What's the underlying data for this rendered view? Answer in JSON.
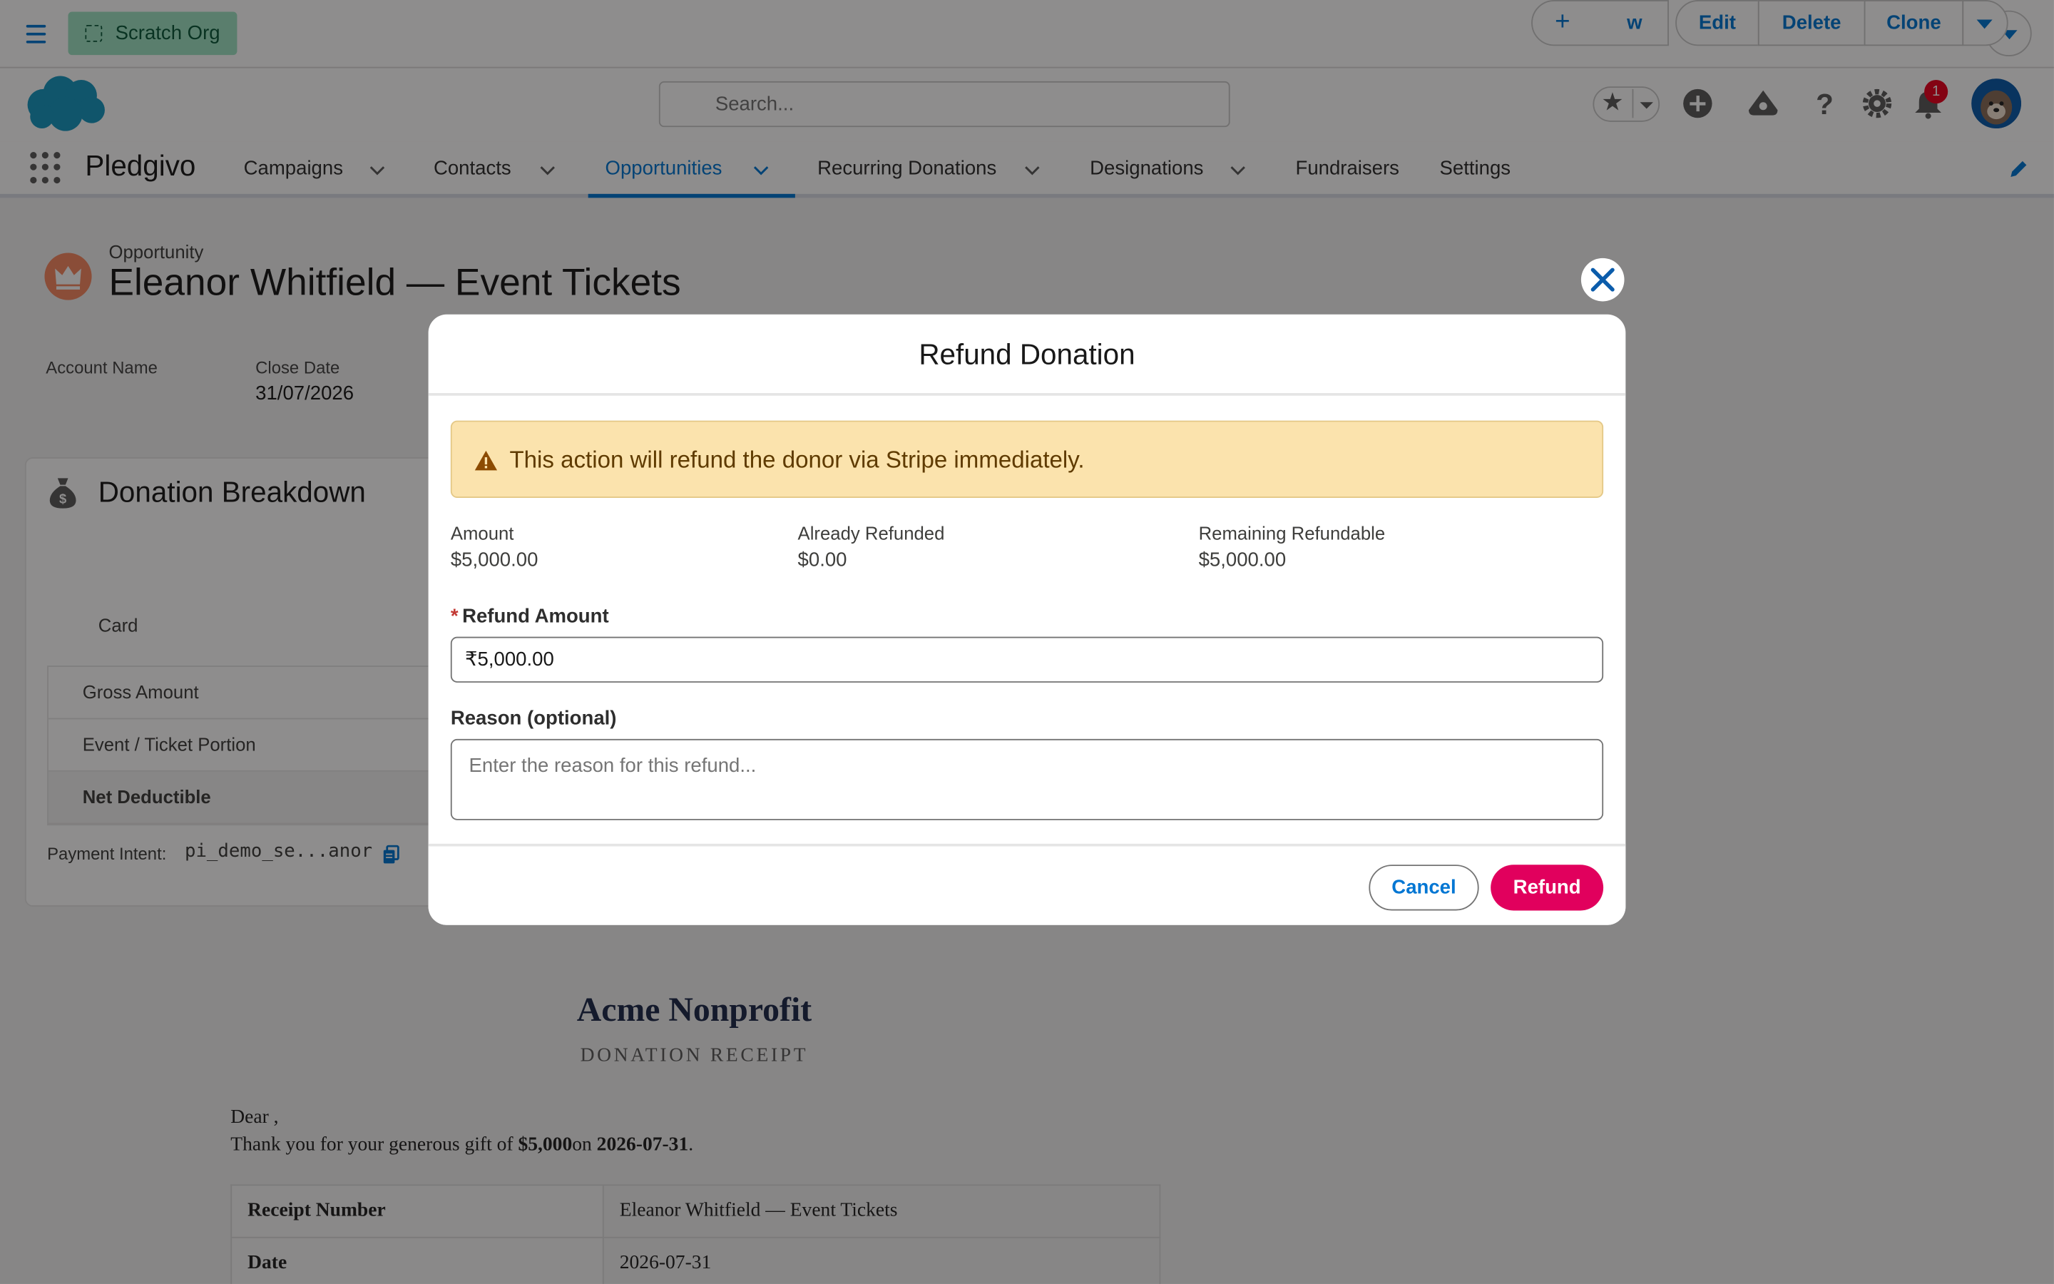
{
  "topbar": {
    "org_badge": "Scratch Org"
  },
  "header": {
    "search_placeholder": "Search...",
    "notification_count": "1"
  },
  "nav": {
    "app_name": "Pledgivo",
    "items": [
      {
        "label": "Campaigns"
      },
      {
        "label": "Contacts"
      },
      {
        "label": "Opportunities"
      },
      {
        "label": "Recurring Donations"
      },
      {
        "label": "Designations"
      },
      {
        "label": "Fundraisers"
      },
      {
        "label": "Settings"
      }
    ]
  },
  "record": {
    "object_label": "Opportunity",
    "title": "Eleanor Whitfield — Event Tickets",
    "actions": {
      "new_partial": "w",
      "edit": "Edit",
      "delete": "Delete",
      "clone": "Clone"
    },
    "highlights": [
      {
        "label": "Account Name",
        "value": ""
      },
      {
        "label": "Close Date",
        "value": "31/07/2026"
      }
    ]
  },
  "breakdown": {
    "title": "Donation Breakdown",
    "column_label": "Card",
    "rows": [
      "Gross Amount",
      "Event / Ticket Portion",
      "Net Deductible"
    ],
    "payment_intent_label": "Payment Intent:",
    "payment_intent_value": "pi_demo_se...anor"
  },
  "receipt": {
    "org": "Acme Nonprofit",
    "subtitle": "DONATION RECEIPT",
    "dear": "Dear ,",
    "thanks_prefix": "Thank you for your generous gift of ",
    "thanks_amount": "$5,000",
    "thanks_mid": "on ",
    "thanks_date": "2026-07-31",
    "thanks_end": ".",
    "rows": [
      {
        "key": "Receipt Number",
        "value": "Eleanor Whitfield — Event Tickets"
      },
      {
        "key": "Date",
        "value": "2026-07-31"
      }
    ]
  },
  "modal": {
    "title": "Refund Donation",
    "warning": "This action will refund the donor via Stripe immediately.",
    "stats": [
      {
        "label": "Amount",
        "value": "$5,000.00"
      },
      {
        "label": "Already Refunded",
        "value": "$0.00"
      },
      {
        "label": "Remaining Refundable",
        "value": "$5,000.00"
      }
    ],
    "refund_amount_label": "Refund Amount",
    "refund_amount_value": "₹5,000.00",
    "reason_label": "Reason (optional)",
    "reason_placeholder": "Enter the reason for this refund...",
    "cancel": "Cancel",
    "refund": "Refund"
  },
  "colors": {
    "brand_blue": "#0176d3",
    "refund_pink": "#e1005d",
    "warning_bg": "#fbe3ad",
    "scratch_badge": "#a0e3c5"
  }
}
